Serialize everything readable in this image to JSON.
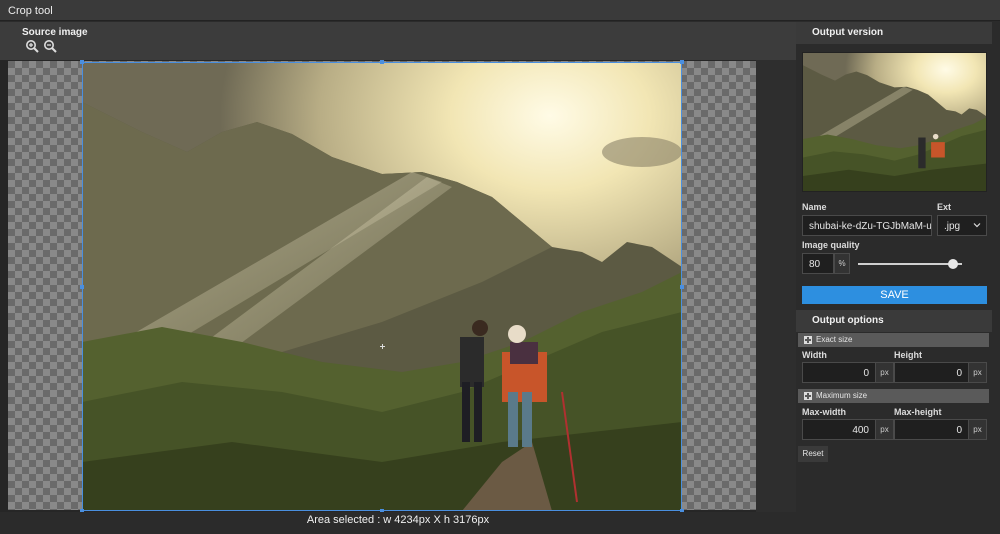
{
  "window": {
    "title": "Crop tool"
  },
  "source": {
    "label": "Source image",
    "zoom_in_icon": "zoom-in-icon",
    "zoom_out_icon": "zoom-out-icon",
    "area_selected": "Area selected : w 4234px X h 3176px"
  },
  "output": {
    "header": "Output version",
    "name_label": "Name",
    "name_value": "shubai-ke-dZu-TGJbMaM-unsplash",
    "ext_label": "Ext",
    "ext_value": ".jpg",
    "quality_label": "Image quality",
    "quality_value": "80",
    "quality_unit": "%",
    "quality_fraction": 0.8,
    "save_label": "SAVE"
  },
  "options": {
    "header": "Output options",
    "exact_size": {
      "label": "Exact size",
      "width_label": "Width",
      "height_label": "Height",
      "width_value": "0",
      "height_value": "0",
      "unit": "px"
    },
    "max_size": {
      "label": "Maximum size",
      "width_label": "Max-width",
      "height_label": "Max-height",
      "width_value": "400",
      "height_value": "0",
      "unit": "px"
    },
    "reset_label": "Reset"
  },
  "colors": {
    "accent": "#2d8fe0",
    "crop_frame": "#4a8fe0"
  }
}
